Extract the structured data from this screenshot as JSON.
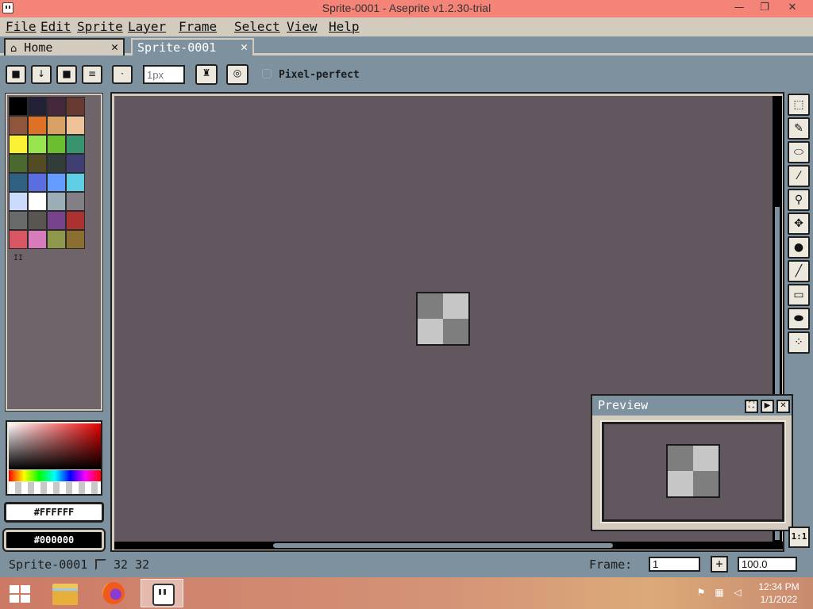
{
  "window": {
    "title": "Sprite-0001 - Aseprite v1.2.30-trial",
    "minimize": "—",
    "maximize": "❐",
    "close": "✕"
  },
  "menu": [
    "File",
    "Edit",
    "Sprite",
    "Layer",
    "Frame",
    "Select",
    "View",
    "Help"
  ],
  "tabs": [
    {
      "label": "Home",
      "close": "✕",
      "active": false
    },
    {
      "label": "Sprite-0001",
      "close": "✕",
      "active": true
    }
  ],
  "context_bar": {
    "brush_size_placeholder": "1px",
    "pixel_perfect_label": "Pixel-perfect",
    "buttons": [
      "lock-icon",
      "down-arrow-icon",
      "square-brush-icon",
      "menu-icon",
      "dot-brush-icon",
      "ink-icon",
      "pressure-icon"
    ]
  },
  "palette": {
    "colors": [
      "#000000",
      "#222034",
      "#45283c",
      "#663931",
      "#8f563b",
      "#df7126",
      "#d9a066",
      "#eec39a",
      "#fbf236",
      "#99e550",
      "#6abe30",
      "#37946e",
      "#4b692f",
      "#524b24",
      "#323c39",
      "#3f3f74",
      "#306082",
      "#5b6ee1",
      "#639bff",
      "#5fcde4",
      "#cbdbfc",
      "#ffffff",
      "#9badb7",
      "#847e87",
      "#696a6a",
      "#595652",
      "#76428a",
      "#ac3232",
      "#d95763",
      "#d77bba",
      "#8f974a",
      "#8a6f30"
    ],
    "grip": "II"
  },
  "colors": {
    "foreground": "#FFFFFF",
    "background": "#000000"
  },
  "preview": {
    "title": "Preview",
    "buttons": [
      "fit-icon",
      "play-icon",
      "close-icon"
    ]
  },
  "toolbar": [
    "marquee-icon",
    "pencil-icon",
    "eraser-icon",
    "eyedropper-icon",
    "zoom-icon",
    "move-icon",
    "paint-bucket-icon",
    "line-icon",
    "rectangle-icon",
    "blur-icon",
    "spray-icon"
  ],
  "zoom_button": "1:1",
  "status": {
    "sprite_name": "Sprite-0001",
    "size": "32 32",
    "frame_label": "Frame:",
    "frame_value": "1",
    "frame_add": "+",
    "zoom_value": "100.0"
  },
  "taskbar": {
    "time": "12:34 PM",
    "date": "1/1/2022"
  }
}
